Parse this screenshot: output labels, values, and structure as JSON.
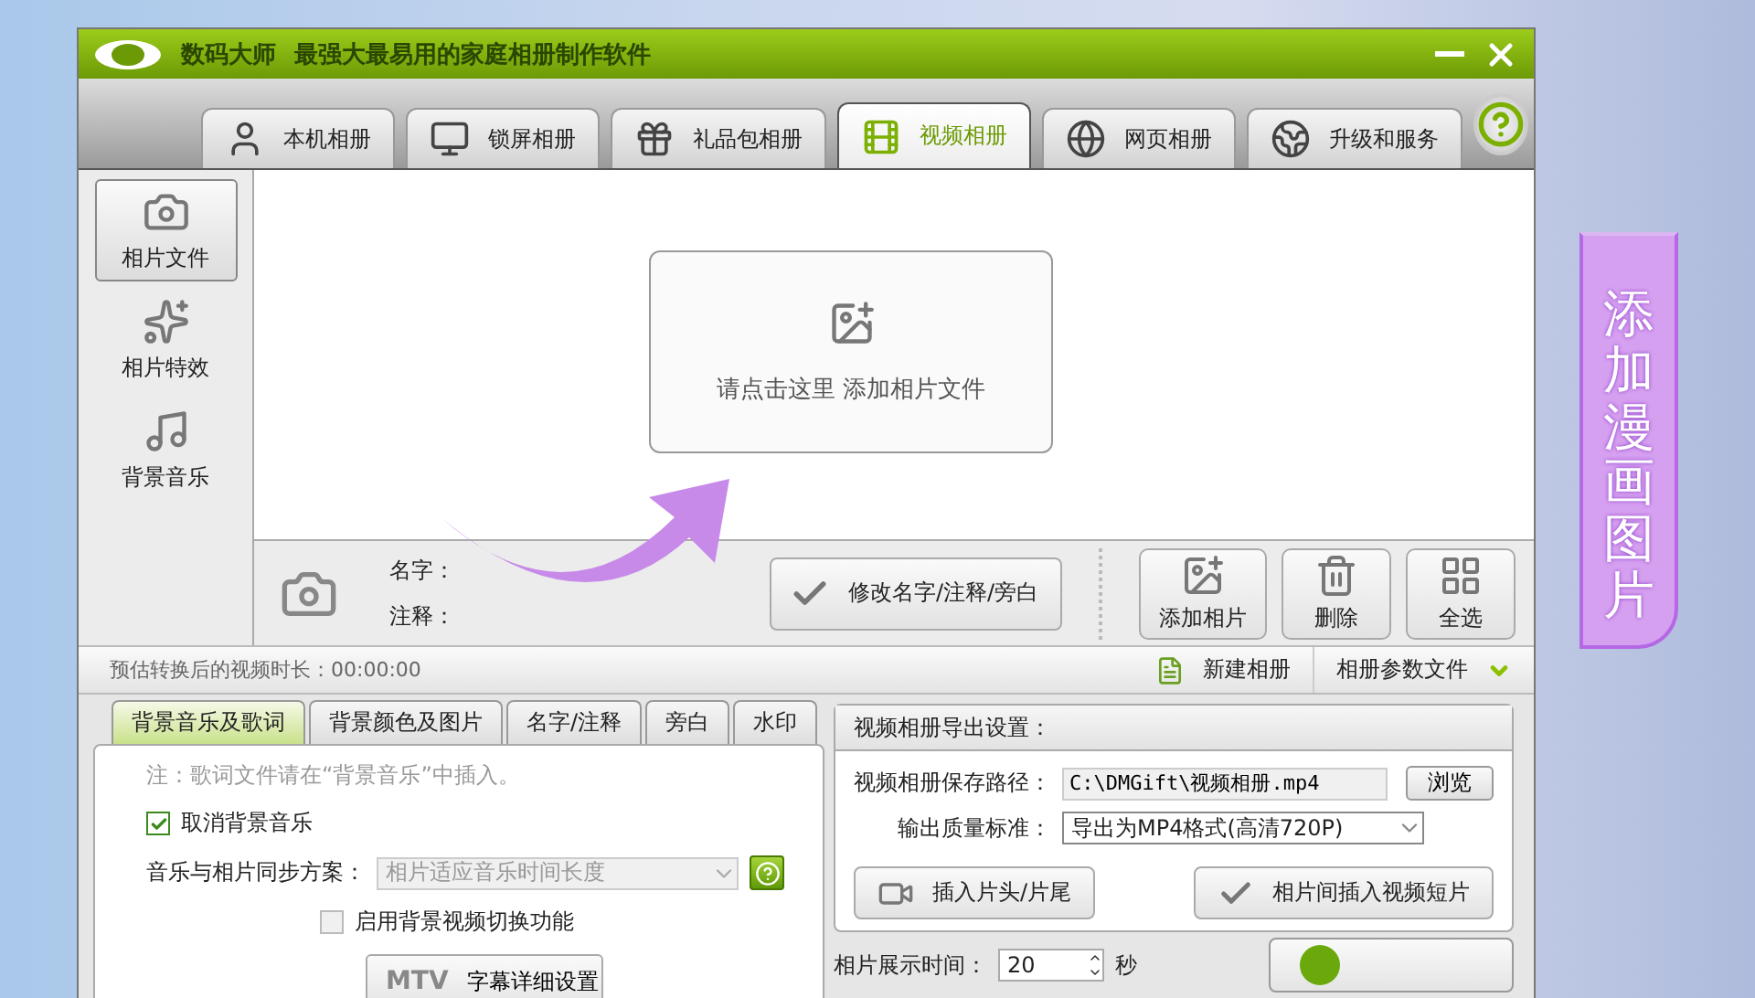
{
  "window": {
    "app_name": "数码大师",
    "slogan": "最强大最易用的家庭相册制作软件"
  },
  "tabs": [
    {
      "label": "本机相册",
      "selected": false
    },
    {
      "label": "锁屏相册",
      "selected": false
    },
    {
      "label": "礼品包相册",
      "selected": false
    },
    {
      "label": "视频相册",
      "selected": true
    },
    {
      "label": "网页相册",
      "selected": false
    },
    {
      "label": "升级和服务",
      "selected": false
    }
  ],
  "sidebar": {
    "items": [
      {
        "label": "相片文件",
        "selected": true
      },
      {
        "label": "相片特效",
        "selected": false
      },
      {
        "label": "背景音乐",
        "selected": false
      }
    ]
  },
  "drop_zone": {
    "text": "请点击这里  添加相片文件"
  },
  "photo_info": {
    "name_label": "名字：",
    "note_label": "注释："
  },
  "actions": {
    "edit_button": "修改名字/注释/旁白",
    "buttons": [
      {
        "label": "添加相片"
      },
      {
        "label": "删除"
      },
      {
        "label": "全选"
      }
    ]
  },
  "status": {
    "duration": "预估转换后的视频时长：00:00:00",
    "new_album": "新建相册",
    "params": "相册参数文件"
  },
  "settings_tabs": [
    {
      "label": "背景音乐及歌词",
      "selected": true
    },
    {
      "label": "背景颜色及图片",
      "selected": false
    },
    {
      "label": "名字/注释",
      "selected": false
    },
    {
      "label": "旁白",
      "selected": false
    },
    {
      "label": "水印",
      "selected": false
    }
  ],
  "lyrics_panel": {
    "note": "注：歌词文件请在“背景音乐”中插入。",
    "cancel_music": {
      "label": "取消背景音乐",
      "checked": true
    },
    "sync_label": "音乐与相片同步方案：",
    "sync_value": "相片适应音乐时间长度",
    "video_switch": {
      "label": "启用背景视频切换功能",
      "checked": false
    },
    "mtv_button": {
      "badge": "MTV",
      "label": "字幕详细设置"
    }
  },
  "export": {
    "title": "视频相册导出设置：",
    "path_label": "视频相册保存路径：",
    "path": "C:\\DMGift\\视频相册.mp4",
    "browse": "浏览",
    "quality_label": "输出质量标准：",
    "quality": "导出为MP4格式(高清720P)",
    "insert_head": "插入片头/片尾",
    "insert_clip": "相片间插入视频短片",
    "duration_label": "相片展示时间：",
    "duration": "20",
    "unit": "秒"
  },
  "banner": {
    "text": "添加漫画图片"
  }
}
